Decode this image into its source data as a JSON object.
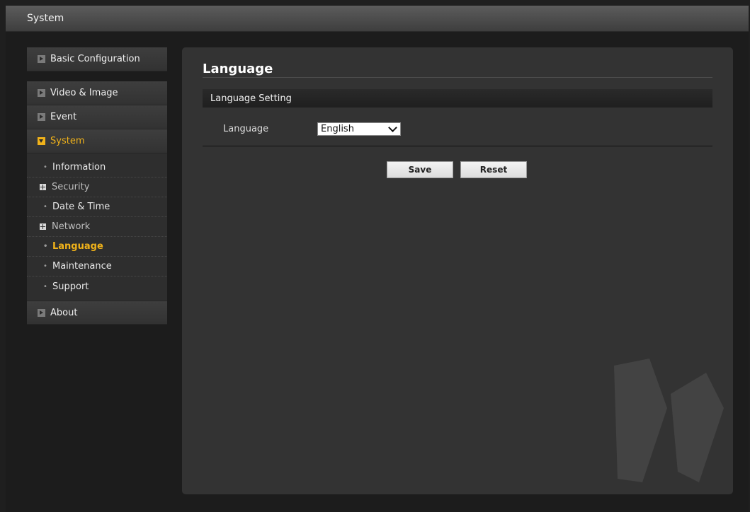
{
  "header": {
    "title": "System"
  },
  "sidebar": {
    "top_item": {
      "label": "Basic Configuration",
      "icon": "expand-arrow-icon"
    },
    "sections": [
      {
        "label": "Video & Image",
        "icon": "expand-arrow-icon"
      },
      {
        "label": "Event",
        "icon": "expand-arrow-icon"
      },
      {
        "label": "System",
        "icon": "collapse-arrow-icon",
        "active": true
      }
    ],
    "system_items": [
      {
        "label": "Information",
        "kind": "leaf"
      },
      {
        "label": "Security",
        "kind": "expandable"
      },
      {
        "label": "Date & Time",
        "kind": "leaf"
      },
      {
        "label": "Network",
        "kind": "expandable"
      },
      {
        "label": "Language",
        "kind": "leaf",
        "current": true
      },
      {
        "label": "Maintenance",
        "kind": "leaf"
      },
      {
        "label": "Support",
        "kind": "leaf"
      }
    ],
    "bottom_item": {
      "label": "About",
      "icon": "expand-arrow-icon"
    }
  },
  "main": {
    "page_title": "Language",
    "section_title": "Language Setting",
    "language_field": {
      "label": "Language",
      "selected": "English"
    },
    "buttons": {
      "save": "Save",
      "reset": "Reset"
    }
  },
  "colors": {
    "accent": "#f0b21a",
    "background": "#1f1f1f",
    "panel": "#333333"
  }
}
